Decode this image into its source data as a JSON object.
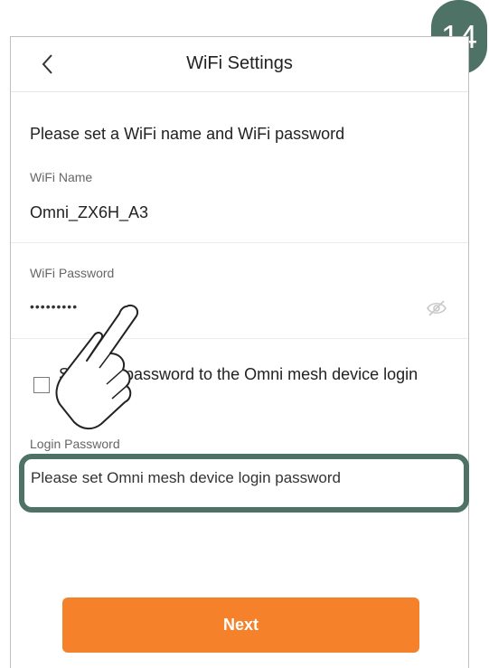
{
  "header": {
    "title": "WiFi Settings",
    "back_icon": "chevron-left-icon"
  },
  "step_badge": "14",
  "form": {
    "intro": "Please set a WiFi name and WiFi password",
    "wifi_name_label": "WiFi Name",
    "wifi_name_value": "Omni_ZX6H_A3",
    "wifi_password_label": "WiFi Password",
    "wifi_password_value": "•••••••••",
    "visibility_icon": "eye-slash-icon",
    "checkbox_label": "Set WiFi password to the Omni mesh device login password",
    "checkbox_checked": false,
    "login_password_label": "Login Password",
    "login_password_placeholder": "Please set Omni mesh device login password"
  },
  "next_button_label": "Next",
  "colors": {
    "accent": "#f5822b",
    "highlight": "#4e7265"
  }
}
